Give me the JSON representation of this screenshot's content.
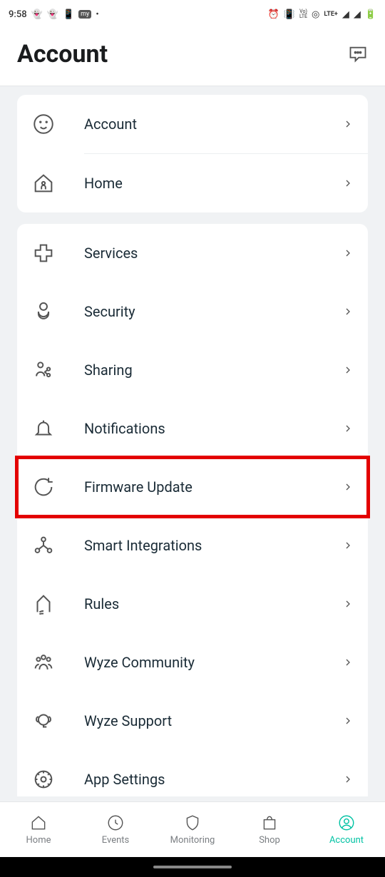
{
  "status": {
    "time": "9:58",
    "lte_label": "LTE+",
    "vo_label": "Vo)\nLTE"
  },
  "header": {
    "title": "Account"
  },
  "groups": [
    {
      "items": [
        {
          "icon": "smiley-icon",
          "label": "Account"
        },
        {
          "icon": "house-person-icon",
          "label": "Home"
        }
      ]
    },
    {
      "items": [
        {
          "icon": "plus-medical-icon",
          "label": "Services"
        },
        {
          "icon": "lock-icon",
          "label": "Security"
        },
        {
          "icon": "share-person-icon",
          "label": "Sharing"
        },
        {
          "icon": "bell-icon",
          "label": "Notifications"
        },
        {
          "icon": "refresh-icon",
          "label": "Firmware Update",
          "highlighted": true
        },
        {
          "icon": "integrations-icon",
          "label": "Smart Integrations"
        },
        {
          "icon": "rules-icon",
          "label": "Rules"
        },
        {
          "icon": "community-icon",
          "label": "Wyze Community"
        },
        {
          "icon": "support-icon",
          "label": "Wyze Support"
        },
        {
          "icon": "gear-icon",
          "label": "App Settings"
        }
      ]
    }
  ],
  "nav": {
    "items": [
      {
        "icon": "home-icon",
        "label": "Home"
      },
      {
        "icon": "clock-icon",
        "label": "Events"
      },
      {
        "icon": "shield-icon",
        "label": "Monitoring"
      },
      {
        "icon": "bag-icon",
        "label": "Shop"
      },
      {
        "icon": "person-circle-icon",
        "label": "Account",
        "active": true
      }
    ]
  }
}
